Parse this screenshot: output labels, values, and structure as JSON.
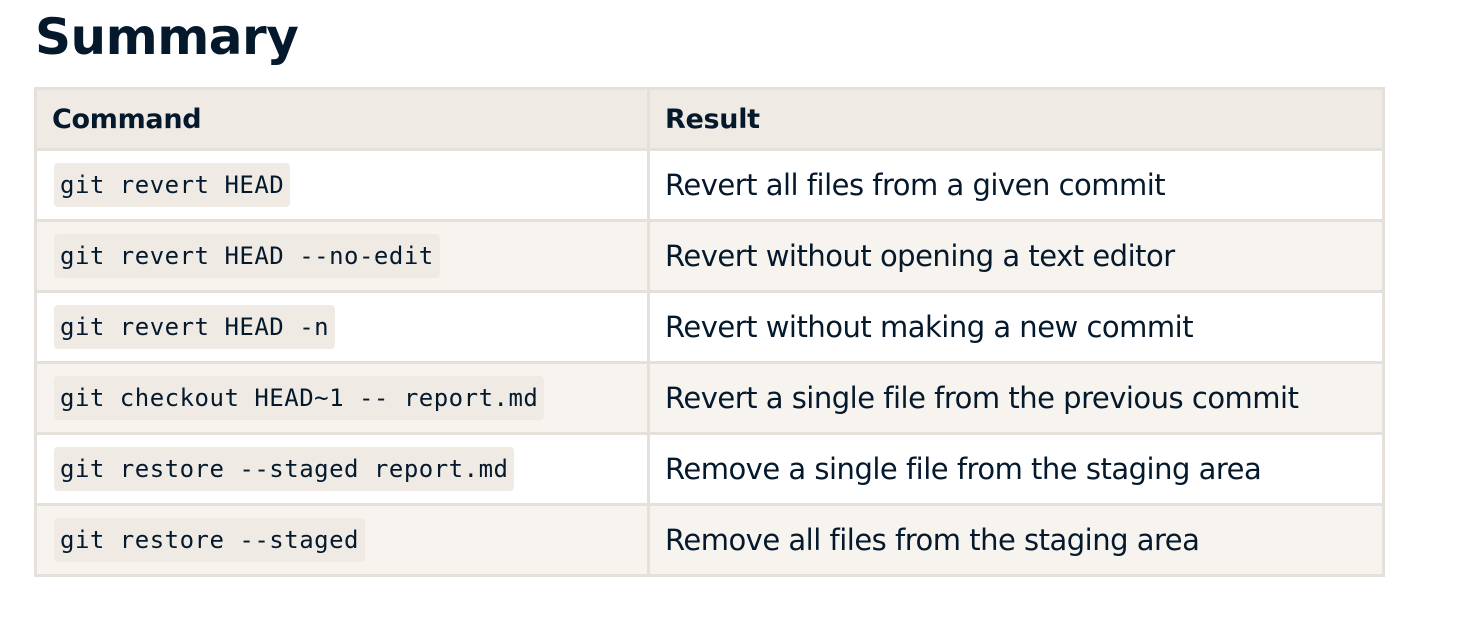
{
  "title": "Summary",
  "table": {
    "headers": [
      "Command",
      "Result"
    ],
    "rows": [
      {
        "command": "git revert HEAD",
        "result": "Revert all files from a given commit"
      },
      {
        "command": "git revert HEAD --no-edit",
        "result": "Revert without opening a text editor"
      },
      {
        "command": "git revert HEAD -n",
        "result": "Revert without making a new commit"
      },
      {
        "command": "git checkout HEAD~1 -- report.md",
        "result": "Revert a single file from the previous commit"
      },
      {
        "command": "git restore --staged report.md",
        "result": "Remove a single file from the staging area"
      },
      {
        "command": "git restore --staged",
        "result": "Remove all files from the staging area"
      }
    ]
  }
}
